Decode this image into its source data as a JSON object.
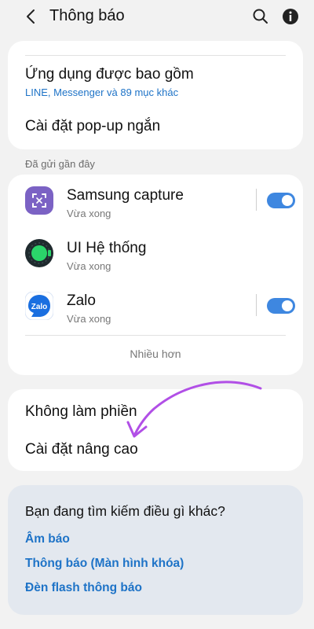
{
  "header": {
    "title": "Thông báo",
    "back_icon": "back-chevron-icon",
    "search_icon": "search-icon",
    "info_icon": "info-icon"
  },
  "settings_top": {
    "included_apps_title": "Ứng dụng được bao gồm",
    "included_apps_sub": "LINE, Messenger và 89 mục khác",
    "popup_title": "Cài đặt pop-up ngắn"
  },
  "recent": {
    "section_label": "Đã gửi gần đây",
    "apps": [
      {
        "name": "Samsung capture",
        "time": "Vừa xong",
        "icon": "samsung-capture-icon",
        "toggle_on": true
      },
      {
        "name": "UI Hệ thống",
        "time": "Vừa xong",
        "icon": "system-ui-icon"
      },
      {
        "name": "Zalo",
        "time": "Vừa xong",
        "icon": "zalo-icon",
        "icon_text": "Zalo",
        "toggle_on": true
      }
    ],
    "more_label": "Nhiều hơn"
  },
  "settings_bottom": {
    "dnd_title": "Không làm phiền",
    "advanced_title": "Cài đặt nâng cao"
  },
  "suggestions": {
    "title": "Bạn đang tìm kiếm điều gì khác?",
    "links": [
      "Âm báo",
      "Thông báo (Màn hình khóa)",
      "Đèn flash thông báo"
    ]
  },
  "colors": {
    "accent": "#1e73c7",
    "toggle": "#3e87e0",
    "annotation_arrow": "#b14fe6"
  }
}
